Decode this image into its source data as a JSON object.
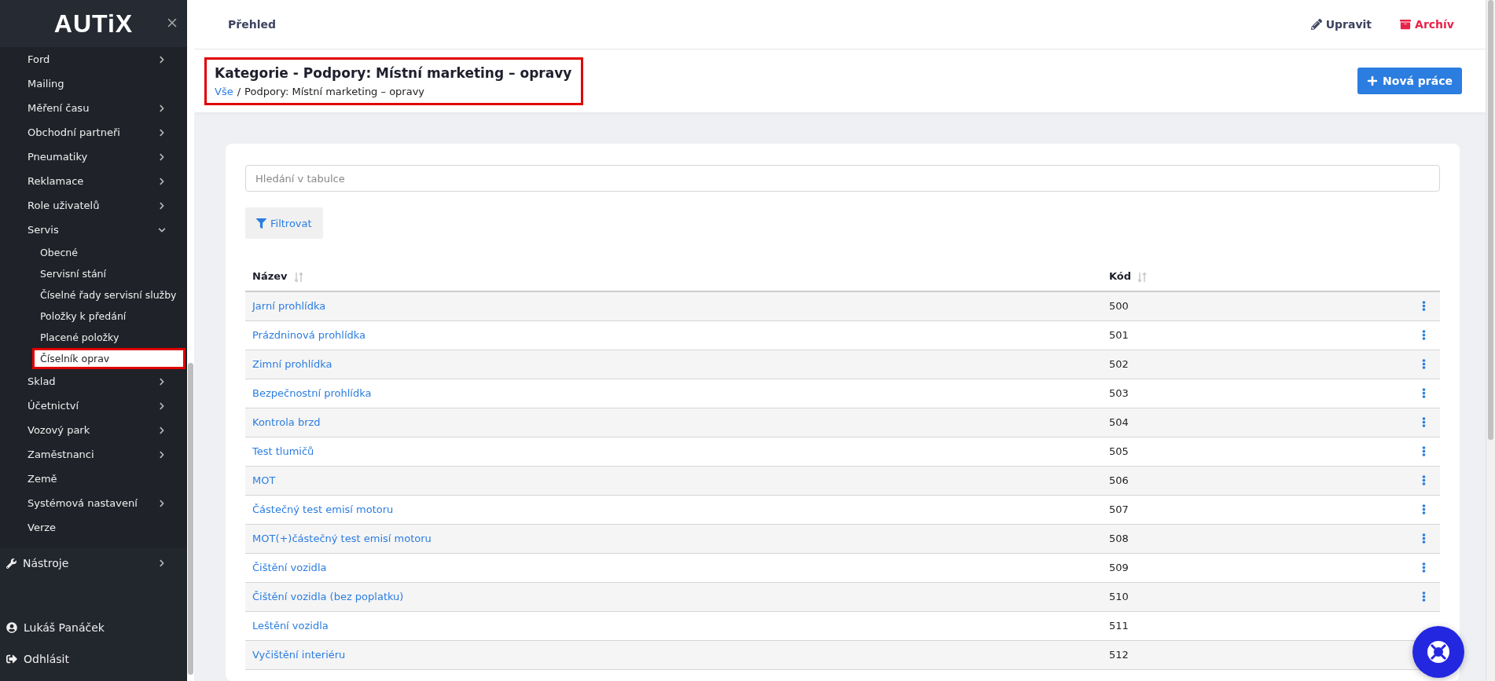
{
  "sidebar": {
    "logo": "AUTiX",
    "items": [
      {
        "label": "Ford",
        "kind": "group",
        "expanded": false
      },
      {
        "label": "Mailing",
        "kind": "link"
      },
      {
        "label": "Měření času",
        "kind": "group",
        "expanded": false
      },
      {
        "label": "Obchodní partneři",
        "kind": "group",
        "expanded": false
      },
      {
        "label": "Pneumatiky",
        "kind": "group",
        "expanded": false
      },
      {
        "label": "Reklamace",
        "kind": "group",
        "expanded": false
      },
      {
        "label": "Role uživatelů",
        "kind": "group",
        "expanded": false
      },
      {
        "label": "Servis",
        "kind": "group",
        "expanded": true,
        "children": [
          {
            "label": "Obecné",
            "selected": false
          },
          {
            "label": "Servisní stání",
            "selected": false
          },
          {
            "label": "Číselné řady servisní služby",
            "selected": false
          },
          {
            "label": "Položky k předání",
            "selected": false
          },
          {
            "label": "Placené položky",
            "selected": false
          },
          {
            "label": "Číselník oprav",
            "selected": true
          }
        ]
      },
      {
        "label": "Sklad",
        "kind": "group",
        "expanded": false
      },
      {
        "label": "Účetnictví",
        "kind": "group",
        "expanded": false
      },
      {
        "label": "Vozový park",
        "kind": "group",
        "expanded": false
      },
      {
        "label": "Zaměstnanci",
        "kind": "group",
        "expanded": false
      },
      {
        "label": "Země",
        "kind": "link"
      },
      {
        "label": "Systémová nastavení",
        "kind": "group",
        "expanded": false
      },
      {
        "label": "Verze",
        "kind": "link"
      }
    ],
    "tools": {
      "label": "Nástroje"
    },
    "user": "Lukáš Panáček",
    "logout": "Odhlásit"
  },
  "topbar": {
    "title": "Přehled",
    "actions": [
      {
        "label": "Upravit",
        "kind": "edit"
      },
      {
        "label": "Archív",
        "kind": "archive"
      }
    ]
  },
  "header": {
    "title": "Kategorie - Podpory: Místní marketing – opravy",
    "highlighted": true,
    "breadcrumb": {
      "link": "Vše",
      "separator": "/",
      "current": "Podpory: Místní marketing – opravy"
    },
    "button": "Nová práce"
  },
  "search": {
    "placeholder": "Hledání v tabulce"
  },
  "filter_button": "Filtrovat",
  "table": {
    "columns": [
      "Název",
      "Kód"
    ],
    "rows": [
      {
        "name": "Jarní prohlídka",
        "code": "500",
        "menu": true
      },
      {
        "name": "Prázdninová prohlídka",
        "code": "501",
        "menu": true
      },
      {
        "name": "Zimní prohlídka",
        "code": "502",
        "menu": true
      },
      {
        "name": "Bezpečnostní prohlídka",
        "code": "503",
        "menu": true
      },
      {
        "name": "Kontrola brzd",
        "code": "504",
        "menu": true
      },
      {
        "name": "Test tlumičů",
        "code": "505",
        "menu": true
      },
      {
        "name": "MOT",
        "code": "506",
        "menu": true
      },
      {
        "name": "Částečný test emisí motoru",
        "code": "507",
        "menu": true
      },
      {
        "name": "MOT(+)částečný test emisí motoru",
        "code": "508",
        "menu": true
      },
      {
        "name": "Čištění vozidla",
        "code": "509",
        "menu": true
      },
      {
        "name": "Čištění vozidla (bez poplatku)",
        "code": "510",
        "menu": true
      },
      {
        "name": "Leštění vozidla",
        "code": "511",
        "menu": false
      },
      {
        "name": "Vyčištění interiéru",
        "code": "512",
        "menu": false
      }
    ]
  }
}
